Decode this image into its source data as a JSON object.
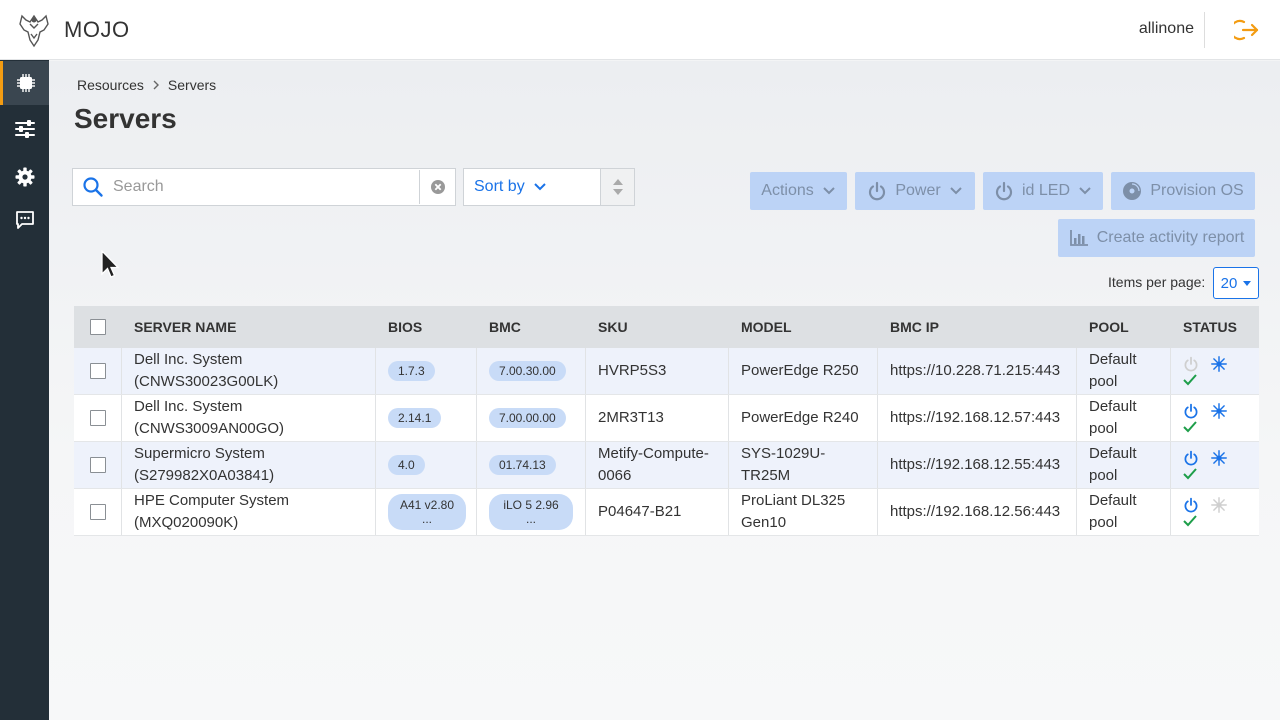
{
  "app": {
    "brand": "MOJO",
    "user": "allinone"
  },
  "sidebar": {
    "items": [
      "cpu-icon",
      "sliders-icon",
      "gear-icon",
      "chat-icon"
    ]
  },
  "breadcrumb": {
    "items": [
      "Resources",
      "Servers"
    ]
  },
  "page": {
    "title": "Servers"
  },
  "search": {
    "placeholder": "Search"
  },
  "sort": {
    "label": "Sort by"
  },
  "actions": {
    "actions": "Actions",
    "power": "Power",
    "idled": "id LED",
    "provision": "Provision OS",
    "report": "Create activity report"
  },
  "pagination": {
    "label": "Items per page:",
    "value": "20"
  },
  "table": {
    "headers": [
      "SERVER NAME",
      "BIOS",
      "BMC",
      "SKU",
      "MODEL",
      "BMC IP",
      "POOL",
      "STATUS"
    ],
    "rows": [
      {
        "name1": "Dell Inc. System",
        "name2": "(CNWS30023G00LK)",
        "bios": "1.7.3",
        "bmc": "7.00.30.00",
        "sku": "HVRP5S3",
        "model": "PowerEdge R250",
        "ip": "https://10.228.71.215:443",
        "pool1": "Default",
        "pool2": "pool"
      },
      {
        "name1": "Dell Inc. System",
        "name2": "(CNWS3009AN00GO)",
        "bios": "2.14.1",
        "bmc": "7.00.00.00",
        "sku": "2MR3T13",
        "model": "PowerEdge R240",
        "ip": "https://192.168.12.57:443",
        "pool1": "Default",
        "pool2": "pool"
      },
      {
        "name1": "Supermicro System",
        "name2": "(S279982X0A03841)",
        "bios": "4.0",
        "bmc": "01.74.13",
        "sku": "Metify-Compute-0066",
        "model": "SYS-1029U-TR25M",
        "ip": "https://192.168.12.55:443",
        "pool1": "Default",
        "pool2": "pool"
      },
      {
        "name1": "HPE Computer System",
        "name2": "(MXQ020090K)",
        "bios": "A41 v2.80 ...",
        "bmc": "iLO 5 2.96 ...",
        "sku": "P04647-B21",
        "model": "ProLiant DL325 Gen10",
        "ip": "https://192.168.12.56:443",
        "pool1": "Default",
        "pool2": "pool"
      }
    ]
  }
}
